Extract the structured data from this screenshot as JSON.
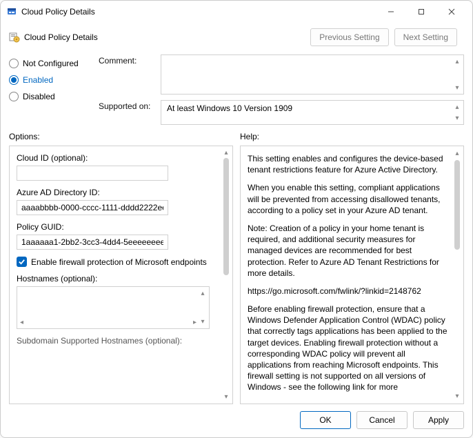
{
  "window": {
    "title": "Cloud Policy Details",
    "subtitle": "Cloud Policy Details"
  },
  "nav": {
    "prev": "Previous Setting",
    "next": "Next Setting"
  },
  "state": {
    "not_configured": "Not Configured",
    "enabled": "Enabled",
    "disabled": "Disabled",
    "selected": "enabled"
  },
  "fields": {
    "comment_label": "Comment:",
    "supported_label": "Supported on:",
    "supported_value": "At least Windows 10 Version 1909"
  },
  "options": {
    "title": "Options:",
    "cloud_id_label": "Cloud ID (optional):",
    "cloud_id_value": "",
    "directory_id_label": "Azure AD Directory ID:",
    "directory_id_value": "aaaabbbb-0000-cccc-1111-dddd2222ee",
    "policy_guid_label": "Policy GUID:",
    "policy_guid_value": "1aaaaaa1-2bb2-3cc3-4dd4-5eeeeeeeeee",
    "firewall_checkbox_label": "Enable firewall protection of Microsoft endpoints",
    "firewall_checked": true,
    "hostnames_label": "Hostnames (optional):",
    "subdomain_label": "Subdomain Supported Hostnames (optional):"
  },
  "help": {
    "title": "Help:",
    "p1": "This setting enables and configures the device-based tenant restrictions feature for Azure Active Directory.",
    "p2": "When you enable this setting, compliant applications will be prevented from accessing disallowed tenants, according to a policy set in your Azure AD tenant.",
    "p3": "Note: Creation of a policy in your home tenant is required, and additional security measures for managed devices are recommended for best protection. Refer to Azure AD Tenant Restrictions for more details.",
    "p4": "https://go.microsoft.com/fwlink/?linkid=2148762",
    "p5": "Before enabling firewall protection, ensure that a Windows Defender Application Control (WDAC) policy that correctly tags applications has been applied to the target devices. Enabling firewall protection without a corresponding WDAC policy will prevent all applications from reaching Microsoft endpoints. This firewall setting is not supported on all versions of Windows - see the following link for more"
  },
  "footer": {
    "ok": "OK",
    "cancel": "Cancel",
    "apply": "Apply"
  }
}
